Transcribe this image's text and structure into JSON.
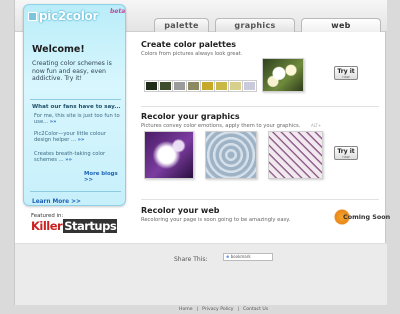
{
  "brand": {
    "logo": "pic2color",
    "beta": "beta"
  },
  "tabs": [
    {
      "label": "palette",
      "active": false
    },
    {
      "label": "graphics",
      "active": false
    },
    {
      "label": "web",
      "active": true
    }
  ],
  "sidebar": {
    "welcome": "Welcome!",
    "intro": "Creating color schemes is now fun and easy, even addictive. Try it!",
    "fans_heading": "What our fans have to say...",
    "quotes": [
      {
        "text": "For me, this site is just too fun to use...",
        "more": "»»"
      },
      {
        "text": "Pic2Color—your little colour design helper ...",
        "more": "»»"
      },
      {
        "text": "Creates breath-taking color schemes ...",
        "more": "»»"
      }
    ],
    "more_blogs": "More blogs >>",
    "learn_more": "Learn More >>",
    "featured_label": "Featured in:",
    "featured_logo": {
      "part1": "Killer",
      "part2": "Startups"
    }
  },
  "sections": {
    "palettes": {
      "title": "Create color palettes",
      "subtitle": "Colors from pictures always look great.",
      "button": "Try it",
      "button_small": "now"
    },
    "graphics": {
      "title": "Recolor your graphics",
      "subtitle": "Pictures convey color emotions, apply them to your graphics.",
      "button": "Try it",
      "button_small": "now",
      "micro_label": "ALT+"
    },
    "web": {
      "title": "Recolor your web",
      "subtitle": "Recoloring your page is soon going to be amazingly easy.",
      "badge": "Coming Soon"
    }
  },
  "palette_swatches": [
    "#1f2c17",
    "#3e4b2d",
    "#9b9b9b",
    "#8c8a63",
    "#c7a92a",
    "#c9b845",
    "#d7cf8d",
    "#c9cadb"
  ],
  "share": {
    "label": "Share This:",
    "service": "bookmark"
  },
  "footer": {
    "links": [
      "Home",
      "Privacy Policy",
      "Contact Us"
    ],
    "separator": "|"
  }
}
